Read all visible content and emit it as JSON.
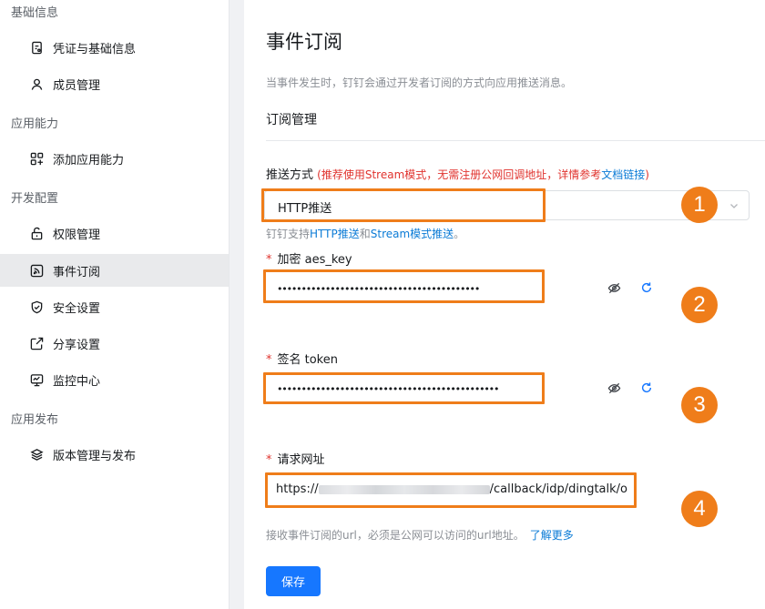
{
  "sidebar": {
    "groups": [
      {
        "title": "基础信息",
        "items": [
          {
            "label": "凭证与基础信息",
            "icon": "credential-icon"
          },
          {
            "label": "成员管理",
            "icon": "person-icon"
          }
        ]
      },
      {
        "title": "应用能力",
        "items": [
          {
            "label": "添加应用能力",
            "icon": "add-capability-icon"
          }
        ]
      },
      {
        "title": "开发配置",
        "items": [
          {
            "label": "权限管理",
            "icon": "unlock-icon"
          },
          {
            "label": "事件订阅",
            "icon": "rss-icon",
            "active": true
          },
          {
            "label": "安全设置",
            "icon": "shield-icon"
          },
          {
            "label": "分享设置",
            "icon": "share-icon"
          },
          {
            "label": "监控中心",
            "icon": "monitor-icon"
          }
        ]
      },
      {
        "title": "应用发布",
        "items": [
          {
            "label": "版本管理与发布",
            "icon": "layers-icon"
          }
        ]
      }
    ]
  },
  "main": {
    "title": "事件订阅",
    "description": "当事件发生时，钉钉会通过开发者订阅的方式向应用推送消息。",
    "section_title": "订阅管理",
    "push_mode": {
      "label": "推送方式",
      "warning_prefix": "(推荐使用Stream模式，无需注册公网回调地址，详情参考",
      "warning_link": "文档链接",
      "warning_suffix": ")",
      "value": "HTTP推送",
      "hint_prefix": "钉钉支持",
      "hint_link1": "HTTP推送",
      "hint_mid": "和",
      "hint_link2": "Stream模式推送",
      "hint_suffix": "。"
    },
    "aes_key": {
      "label": "加密 aes_key",
      "masked_value": "••••••••••••••••••••••••••••••••••••••••••"
    },
    "token": {
      "label": "签名 token",
      "masked_value": "••••••••••••••••••••••••••••••••••••••••••••••"
    },
    "request_url": {
      "label": "请求网址",
      "value_prefix": "https://",
      "value_suffix": "/callback/idp/dingtalk/o",
      "hint": "接收事件订阅的url，必须是公网可以访问的url地址。",
      "hint_link": "了解更多"
    },
    "save_label": "保存"
  },
  "annotations": [
    "1",
    "2",
    "3",
    "4"
  ],
  "colors": {
    "primary": "#1677ff",
    "link": "#0b7bd6",
    "warning": "#e0332e",
    "annotation": "#ef7d1a",
    "active_nav_bg": "#e9eaec"
  }
}
